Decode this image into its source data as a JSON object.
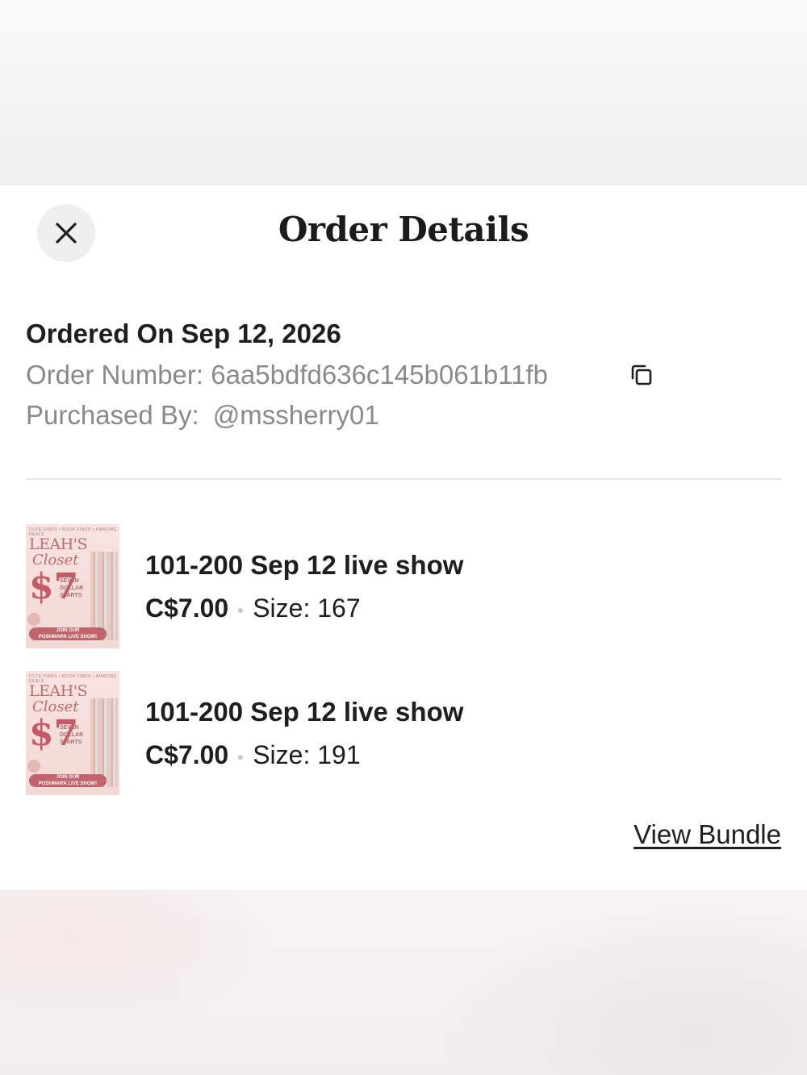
{
  "header": {
    "title": "Order Details",
    "close_icon": "close-icon"
  },
  "order": {
    "ordered_on": "Ordered On Sep 12, 2026",
    "order_number_label": "Order Number:",
    "order_number": "6aa5bdfd636c145b061b11fb",
    "copy_icon": "copy-icon",
    "purchased_by_label": "Purchased By:",
    "purchased_by": "@mssherry01"
  },
  "items": [
    {
      "title": "101-200 Sep 12 live show",
      "price": "C$7.00",
      "size_label": "Size:",
      "size": "167",
      "thumb": {
        "top": "CUTE FINDS • BOOK FINDS • AMAZING DEALS",
        "name": "LEAH'S",
        "sub": "Closet",
        "amount": "$7",
        "line1": "SEVEN",
        "line2": "DOLLAR",
        "line3": "STARTS",
        "banner1": "JOIN OUR",
        "banner2": "POSHMARK LIVE SHOW!"
      }
    },
    {
      "title": "101-200 Sep 12 live show",
      "price": "C$7.00",
      "size_label": "Size:",
      "size": "191",
      "thumb": {
        "top": "CUTE FINDS • BOOK FINDS • AMAZING DEALS",
        "name": "LEAH'S",
        "sub": "Closet",
        "amount": "$7",
        "line1": "SEVEN",
        "line2": "DOLLAR",
        "line3": "STARTS",
        "banner1": "JOIN OUR",
        "banner2": "POSHMARK LIVE SHOW!"
      }
    }
  ],
  "footer": {
    "view_bundle": "View Bundle"
  }
}
